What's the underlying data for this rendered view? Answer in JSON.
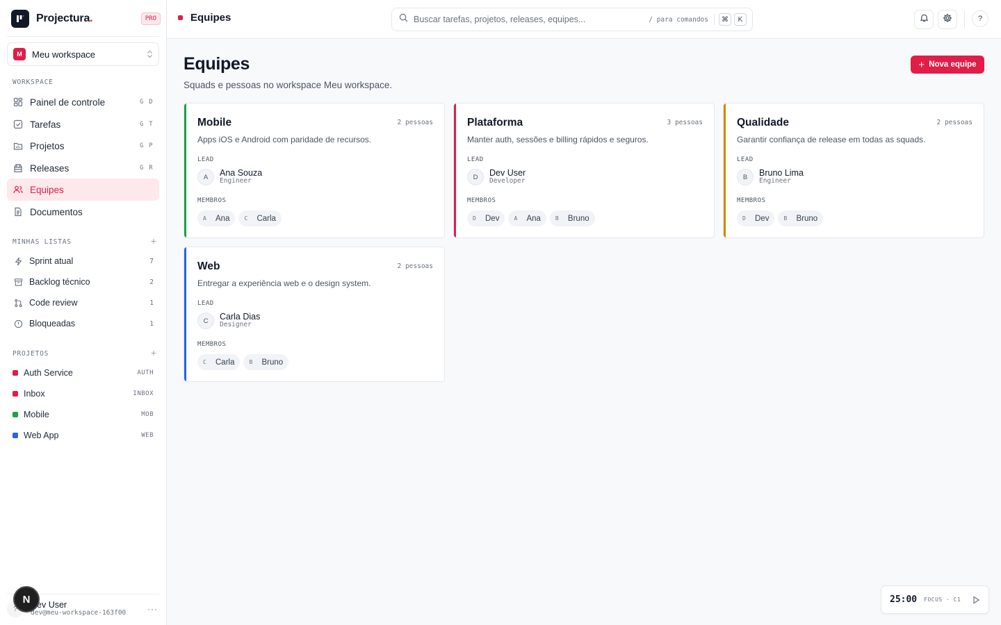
{
  "brand": {
    "name": "Projectura",
    "dot": ".",
    "badge": "PRO"
  },
  "workspace": {
    "initial": "M",
    "name": "Meu workspace"
  },
  "sidebar": {
    "workspace_label": "WORKSPACE",
    "nav": [
      {
        "label": "Painel de controle",
        "shortcut": "G D",
        "icon": "dashboard-icon"
      },
      {
        "label": "Tarefas",
        "shortcut": "G T",
        "icon": "checkbox-icon"
      },
      {
        "label": "Projetos",
        "shortcut": "G P",
        "icon": "folder-icon"
      },
      {
        "label": "Releases",
        "shortcut": "G R",
        "icon": "package-icon"
      },
      {
        "label": "Equipes",
        "shortcut": "",
        "icon": "users-icon",
        "active": true
      },
      {
        "label": "Documentos",
        "shortcut": "",
        "icon": "document-icon"
      }
    ],
    "lists_label": "MINHAS LISTAS",
    "lists": [
      {
        "label": "Sprint atual",
        "count": "7",
        "icon": "bolt-icon"
      },
      {
        "label": "Backlog técnico",
        "count": "2",
        "icon": "archive-icon"
      },
      {
        "label": "Code review",
        "count": "1",
        "icon": "git-pull-request-icon"
      },
      {
        "label": "Bloqueadas",
        "count": "1",
        "icon": "alert-circle-icon"
      }
    ],
    "projects_label": "PROJETOS",
    "projects": [
      {
        "label": "Auth Service",
        "code": "AUTH",
        "color": "#e11d48"
      },
      {
        "label": "Inbox",
        "code": "INBOX",
        "color": "#e11d48"
      },
      {
        "label": "Mobile",
        "code": "MOB",
        "color": "#16a34a"
      },
      {
        "label": "Web App",
        "code": "WEB",
        "color": "#2563eb"
      }
    ],
    "user": {
      "initial": "?",
      "name": "Dev User",
      "email": "dev@meu-workspace-163f00"
    },
    "next_badge": "N"
  },
  "topbar": {
    "title": "Equipes",
    "search_placeholder": "Buscar tarefas, projetos, releases, equipes...",
    "search_hint": "/ para comandos",
    "kbd_cmd": "⌘",
    "kbd_k": "K",
    "help": "?"
  },
  "main": {
    "title": "Equipes",
    "subtitle": "Squads e pessoas no workspace Meu workspace.",
    "new_button": "Nova equipe",
    "lead_label": "LEAD",
    "members_label": "MEMBROS",
    "teams": [
      {
        "name": "Mobile",
        "count": "2 pessoas",
        "color": "#16a34a",
        "description": "Apps iOS e Android com paridade de recursos.",
        "lead": {
          "initial": "A",
          "name": "Ana Souza",
          "role": "Engineer"
        },
        "members": [
          {
            "initial": "A",
            "name": "Ana"
          },
          {
            "initial": "C",
            "name": "Carla"
          }
        ]
      },
      {
        "name": "Plataforma",
        "count": "3 pessoas",
        "color": "#e11d48",
        "description": "Manter auth, sessões e billing rápidos e seguros.",
        "lead": {
          "initial": "D",
          "name": "Dev User",
          "role": "Developer"
        },
        "members": [
          {
            "initial": "D",
            "name": "Dev"
          },
          {
            "initial": "A",
            "name": "Ana"
          },
          {
            "initial": "B",
            "name": "Bruno"
          }
        ]
      },
      {
        "name": "Qualidade",
        "count": "2 pessoas",
        "color": "#ca8a04",
        "description": "Garantir confiança de release em todas as squads.",
        "lead": {
          "initial": "B",
          "name": "Bruno Lima",
          "role": "Engineer"
        },
        "members": [
          {
            "initial": "D",
            "name": "Dev"
          },
          {
            "initial": "B",
            "name": "Bruno"
          }
        ]
      },
      {
        "name": "Web",
        "count": "2 pessoas",
        "color": "#2563eb",
        "description": "Entregar a experiência web e o design system.",
        "lead": {
          "initial": "C",
          "name": "Carla Dias",
          "role": "Designer"
        },
        "members": [
          {
            "initial": "C",
            "name": "Carla"
          },
          {
            "initial": "B",
            "name": "Bruno"
          }
        ]
      }
    ]
  },
  "timer": {
    "time": "25:00",
    "mode": "FOCUS · C1"
  }
}
